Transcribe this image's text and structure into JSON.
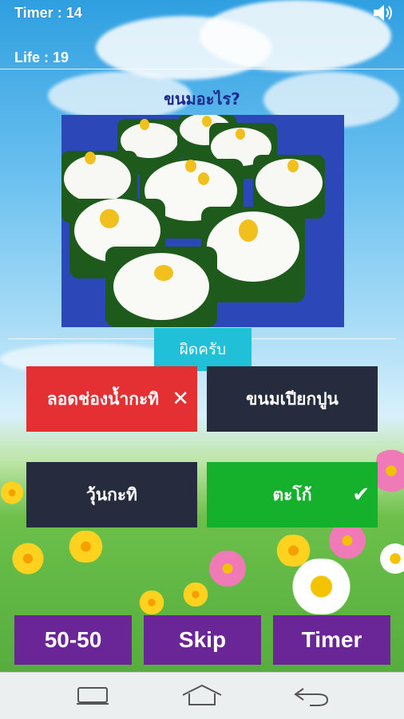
{
  "status": {
    "timer_text": "Timer  : 14",
    "life_text": "Life : 19"
  },
  "question": {
    "text": "ขนมอะไร?"
  },
  "result": {
    "text": "ผิดครับ"
  },
  "answers": [
    {
      "label": "ลอดช่องน้ำกะทิ",
      "state": "wrong",
      "color": "#e53033",
      "mark": "✕"
    },
    {
      "label": "ขนมเปียกปูน",
      "state": "neutral",
      "color": "#262b3d",
      "mark": ""
    },
    {
      "label": "วุ้นกะทิ",
      "state": "neutral",
      "color": "#262b3d",
      "mark": ""
    },
    {
      "label": "ตะโก้",
      "state": "correct",
      "color": "#16b12c",
      "mark": "✔"
    }
  ],
  "lifelines": {
    "fifty_label": "50-50",
    "skip_label": "Skip",
    "timer_label": "Timer"
  },
  "colors": {
    "lifeline_bg": "#6a2596",
    "result_bg": "#1fc0d8",
    "question_text": "#1e2a8c"
  },
  "icons": {
    "sound": "speaker-icon",
    "nav": [
      "recent-apps-icon",
      "home-icon",
      "back-icon"
    ]
  }
}
